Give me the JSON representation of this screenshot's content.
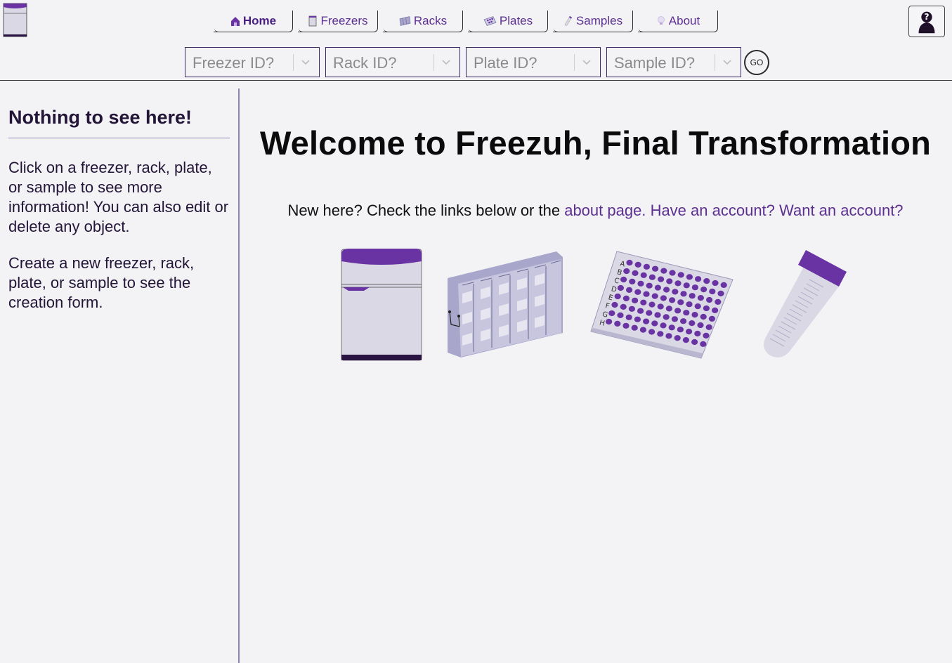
{
  "nav": {
    "tabs": [
      {
        "label": "Home",
        "icon": "house-icon",
        "active": true
      },
      {
        "label": "Freezers",
        "icon": "freezer-icon",
        "active": false
      },
      {
        "label": "Racks",
        "icon": "rack-icon",
        "active": false
      },
      {
        "label": "Plates",
        "icon": "plate-icon",
        "active": false
      },
      {
        "label": "Samples",
        "icon": "tube-icon",
        "active": false
      },
      {
        "label": "About",
        "icon": "lightbulb-icon",
        "active": false
      }
    ]
  },
  "search": {
    "freezer_placeholder": "Freezer ID?",
    "rack_placeholder": "Rack ID?",
    "plate_placeholder": "Plate ID?",
    "sample_placeholder": "Sample ID?",
    "go_label": "GO"
  },
  "sidebar": {
    "title": "Nothing to see here!",
    "paragraph1": "Click on a freezer, rack, plate, or sample to see more information! You can also edit or delete any object.",
    "paragraph2": "Create a new freezer, rack, plate, or sample to see the creation form."
  },
  "main": {
    "title": "Welcome to Freezuh, Final Transformation",
    "intro_text": "New here? Check the links below or the ",
    "about_link": "about page.",
    "login_link": "Have an account?",
    "signup_link": "Want an account?",
    "plate_rows": [
      "A",
      "B",
      "C",
      "D",
      "E",
      "F",
      "G",
      "H"
    ]
  },
  "colors": {
    "accent": "#6a33a3",
    "link": "#5c2f91",
    "text": "#231537",
    "background": "#f3f3f6"
  }
}
